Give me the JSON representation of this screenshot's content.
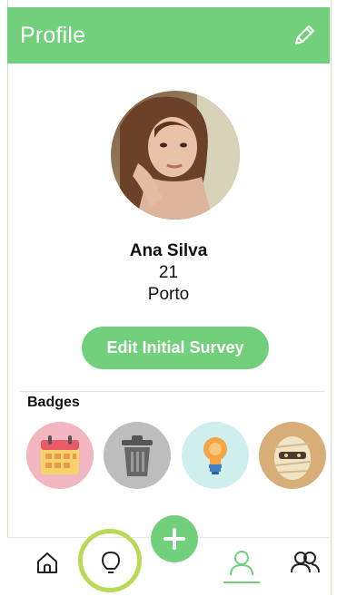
{
  "header": {
    "title": "Profile",
    "edit_icon": "pencil-icon"
  },
  "profile": {
    "name": "Ana Silva",
    "age": "21",
    "city": "Porto"
  },
  "actions": {
    "survey_label": "Edit Initial Survey"
  },
  "badges": {
    "title": "Badges",
    "items": [
      {
        "icon": "calendar-icon",
        "color": "#f2b6c0"
      },
      {
        "icon": "trash-can-icon",
        "color": "#bdbdbd"
      },
      {
        "icon": "lightbulb-icon",
        "color": "#cfeeee"
      },
      {
        "icon": "mummy-icon",
        "color": "#d8ae78"
      }
    ]
  },
  "nav": {
    "items": [
      {
        "icon": "home-icon"
      },
      {
        "icon": "lightbulb-icon"
      },
      {
        "icon": "plus-icon"
      },
      {
        "icon": "user-icon",
        "active": true
      },
      {
        "icon": "friends-icon"
      }
    ]
  },
  "colors": {
    "accent": "#72d07d",
    "highlight": "#b9d957"
  }
}
